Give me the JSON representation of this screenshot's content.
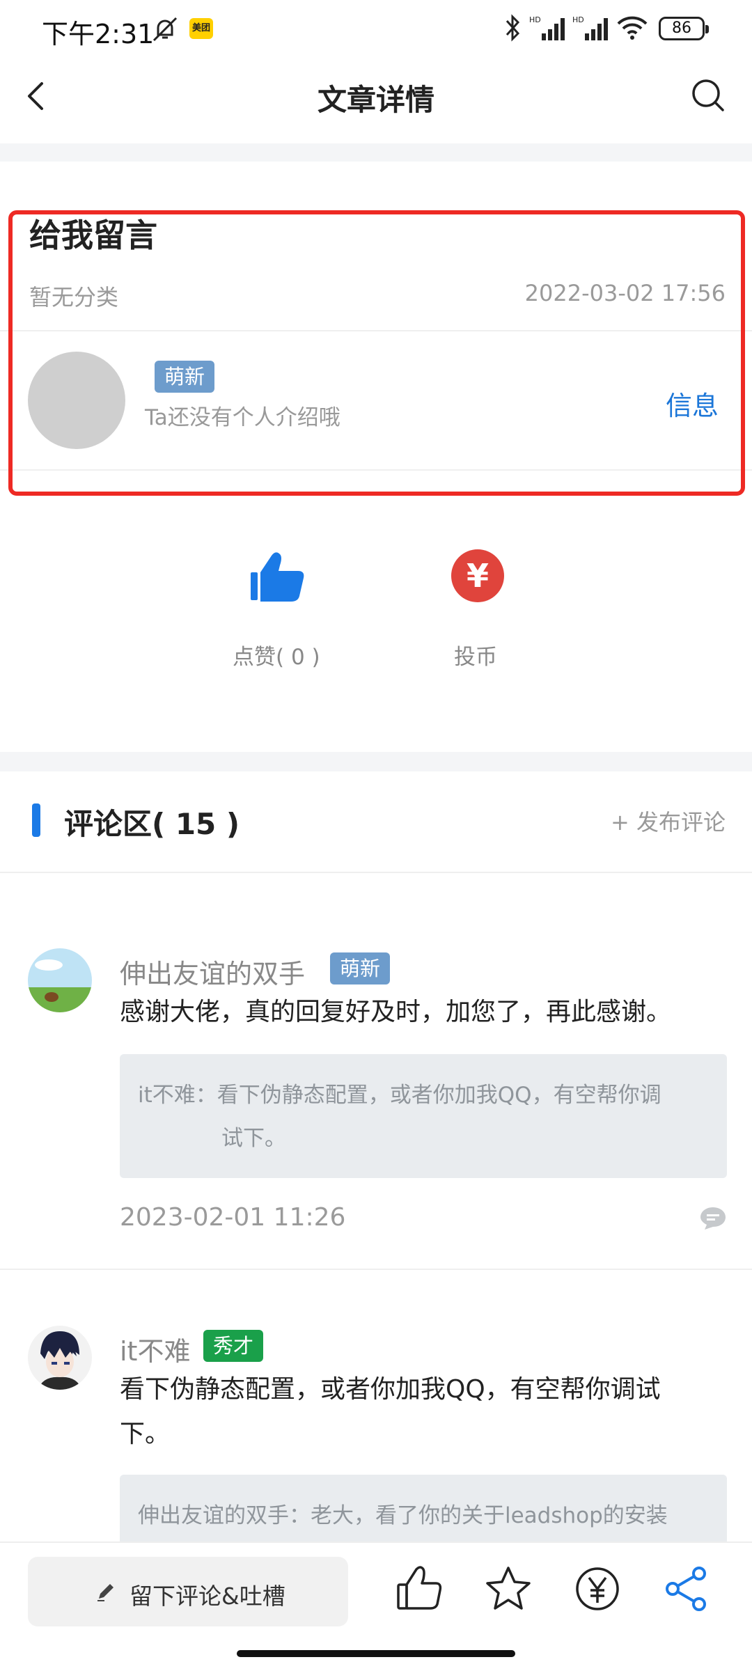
{
  "status_bar": {
    "time": "下午2:31",
    "app_badge": "美团",
    "battery": "86"
  },
  "header": {
    "title": "文章详情"
  },
  "article": {
    "title": "给我留言",
    "category": "暂无分类",
    "date": "2022-03-02 17:56",
    "author": {
      "badge": "萌新",
      "intro": "Ta还没有个人介绍哦",
      "info_link": "信息"
    }
  },
  "actions": {
    "like_label": "点赞( 0 )",
    "coin_symbol": "¥",
    "coin_label": "投币"
  },
  "comments": {
    "title": "评论区( 15 )",
    "publish": "+ 发布评论",
    "items": [
      {
        "name": "伸出友谊的双手",
        "badge": "萌新",
        "text": "感谢大佬，真的回复好及时，加您了，再此感谢。",
        "reply_name": "it不难：",
        "reply_line1": "看下伪静态配置，或者你加我QQ，有空帮你调",
        "reply_line2": "试下。",
        "time": "2023-02-01 11:26"
      },
      {
        "name": "it不难",
        "badge": "秀才",
        "text_line1": "看下伪静态配置，或者你加我QQ，有空帮你调试",
        "text_line2": "下。",
        "reply_name": "伸出友谊的双手：",
        "reply_line1": "老大，看了你的关于leadshop的安装"
      }
    ]
  },
  "bottom_bar": {
    "input_placeholder": "留下评论&吐槽"
  },
  "colors": {
    "accent_blue": "#1b76d8",
    "highlight_red": "#ee2a24",
    "badge_blue": "#6d9ccc",
    "badge_green": "#1aa04a",
    "coin_red": "#e0443c"
  }
}
